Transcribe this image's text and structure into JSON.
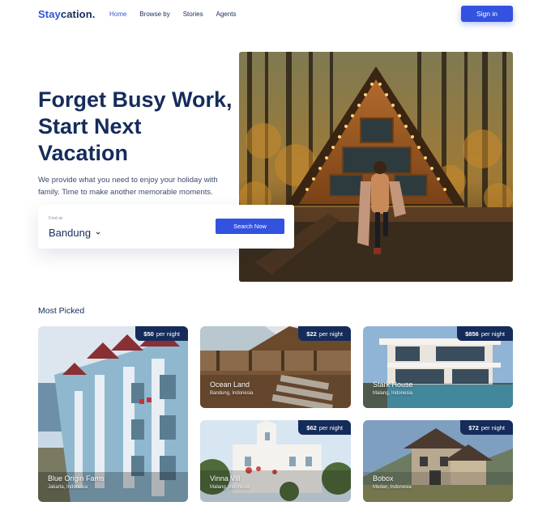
{
  "brand": {
    "first": "Stay",
    "second": "cation."
  },
  "nav": {
    "items": [
      "Home",
      "Browse by",
      "Stories",
      "Agents"
    ],
    "active_index": 0
  },
  "signin_label": "Sign in",
  "hero": {
    "title": "Forget Busy Work, Start Next Vacation",
    "subtitle": "We provide what you need to enjoy your  holiday with family. Time to make another memorable moments."
  },
  "search": {
    "find_label": "Find at:",
    "city": "Bandung",
    "button_label": "Search Now"
  },
  "most_picked": {
    "title": "Most Picked",
    "items": [
      {
        "price": "$50",
        "unit": "per night",
        "name": "Blue Origin Fams",
        "location": "Jakarta, Indonesia"
      },
      {
        "price": "$22",
        "unit": "per night",
        "name": "Ocean Land",
        "location": "Bandung, Indonesia"
      },
      {
        "price": "$856",
        "unit": "per night",
        "name": "Stark House",
        "location": "Malang, Indonesia"
      },
      {
        "price": "$62",
        "unit": "per night",
        "name": "Vinna Vill",
        "location": "Malang, Indonesia"
      },
      {
        "price": "$72",
        "unit": "per night",
        "name": "Bobox",
        "location": "Medan, Indonesia"
      }
    ]
  },
  "colors": {
    "primary": "#3252DF",
    "navy": "#152C5B"
  }
}
